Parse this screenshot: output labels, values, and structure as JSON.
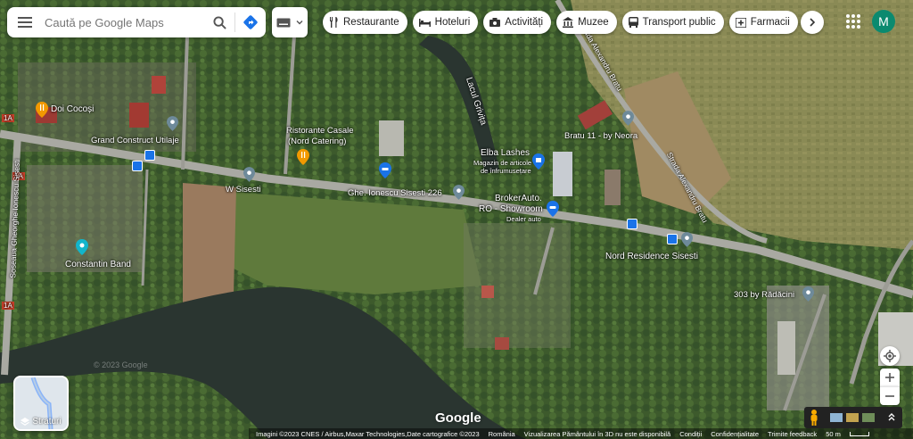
{
  "search": {
    "placeholder": "Caută pe Google Maps"
  },
  "chips": [
    {
      "label": "Restaurante",
      "icon": "fork-knife-icon"
    },
    {
      "label": "Hoteluri",
      "icon": "bed-icon"
    },
    {
      "label": "Activități",
      "icon": "camera-icon"
    },
    {
      "label": "Muzee",
      "icon": "museum-icon"
    },
    {
      "label": "Transport public",
      "icon": "bus-icon"
    },
    {
      "label": "Farmacii",
      "icon": "pharmacy-icon"
    }
  ],
  "account": {
    "initial": "M",
    "color": "#0b8a6f"
  },
  "places": {
    "doi_cocosi": "Doi Cocoși",
    "grand_construct": "Grand Construct Utilaje",
    "ristorante_line1": "Ristorante Casale",
    "ristorante_line2": "(Nord Catering)",
    "w_sisesti": "W Sisesti",
    "ghe_ionescu_226": "Ghe. Ionescu Sisesti 226",
    "elba_lashes": "Elba Lashes",
    "elba_sub1": "Magazin de articole",
    "elba_sub2": "de înfrumusețare",
    "broker_line1": "BrokerAuto.",
    "broker_line2": "RO - Showroom",
    "broker_sub": "Dealer auto",
    "bratu_11": "Bratu 11 - by Neora",
    "nord_residence": "Nord Residence Sisesti",
    "radacini": "303 by Rădăcini",
    "constantin_band": "Constantin Band",
    "lacul_grivita": "Lacul Grivița",
    "strada_bratu": "Strada Alexandru Bratu",
    "soseaua": "Soseaua Gheorghe Ionescu Sisesti",
    "road_1a": "1A"
  },
  "layers": {
    "label": "Straturi"
  },
  "google_logo": "Google",
  "watermark": "© 2023 Google",
  "footer": {
    "imagery": "Imagini ©2023 CNES / Airbus,Maxar Technologies,Date cartografice ©2023",
    "country": "România",
    "view3d": "Vizualizarea Pământului în 3D nu este disponibilă",
    "terms": "Condiții",
    "privacy": "Confidențialitate",
    "feedback": "Trimite feedback",
    "scale": "50 m"
  },
  "colors": {
    "accent": "#1a73e8",
    "pin_blue": "#1a73e8",
    "pin_orange": "#f29900",
    "pin_teal": "#12b5cb",
    "pin_gray": "#6e8a9a"
  }
}
